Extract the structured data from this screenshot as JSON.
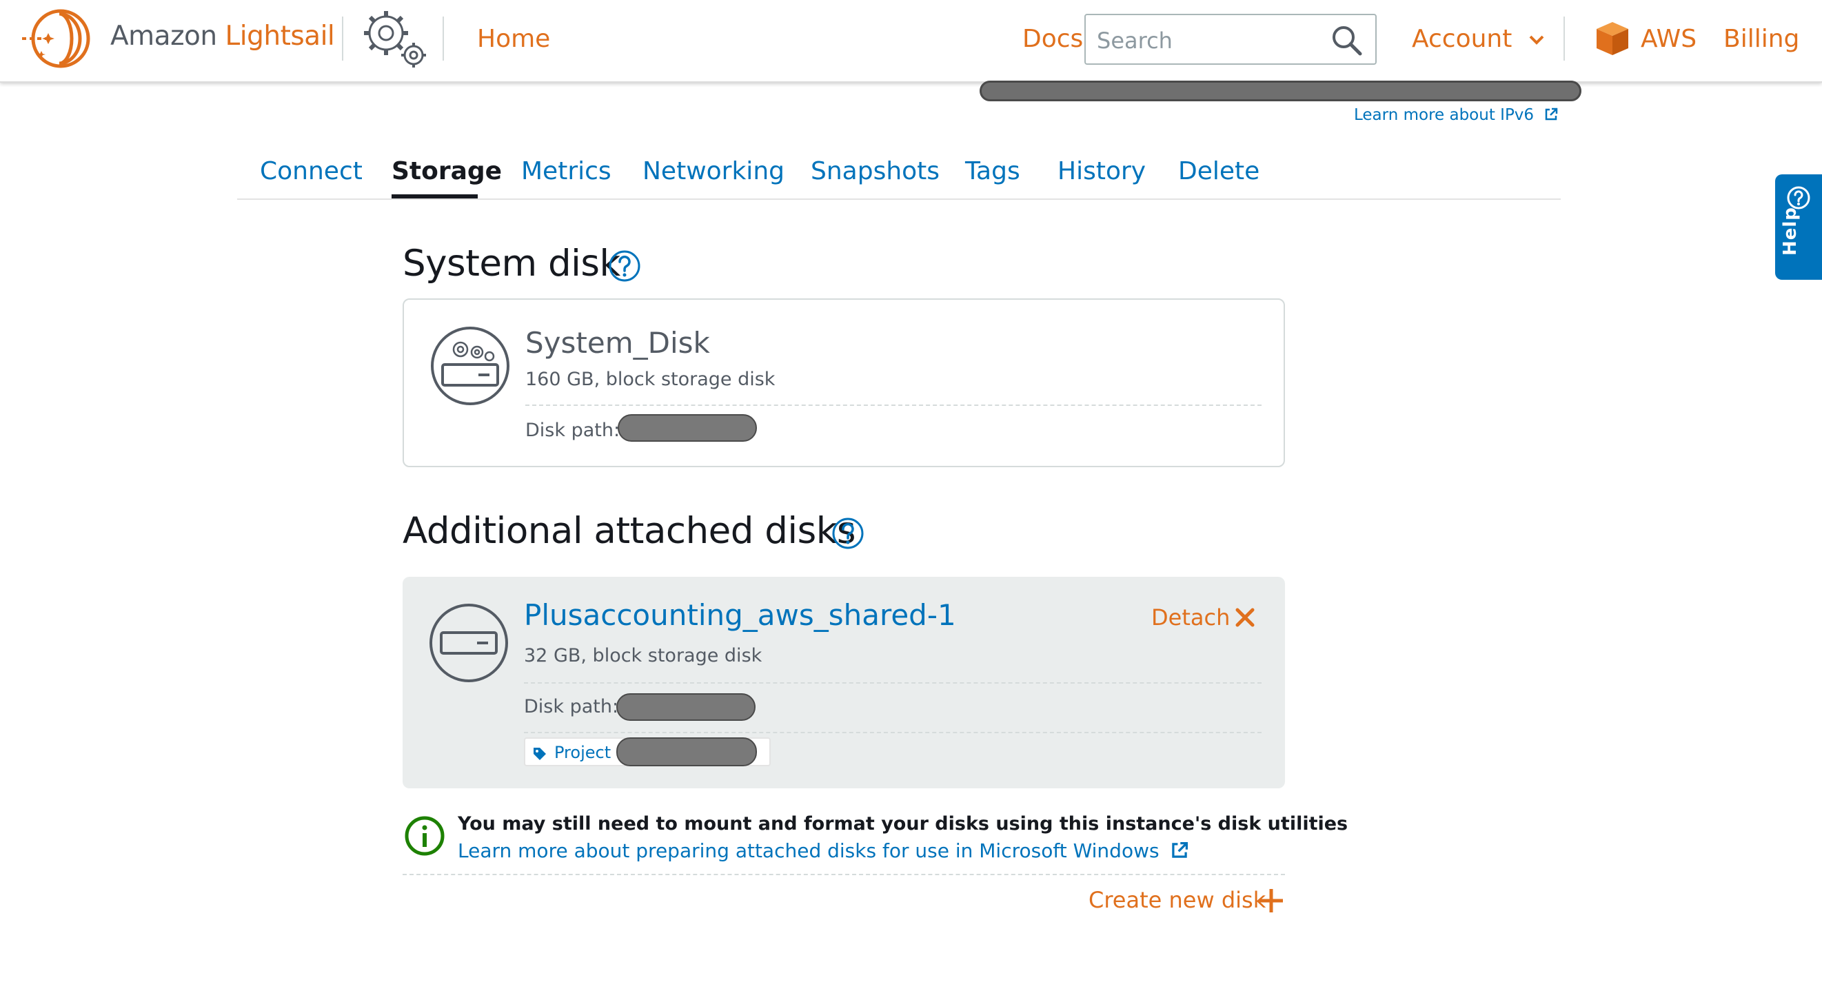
{
  "header": {
    "brand_part1": "Amazon",
    "brand_part2": "Lightsail",
    "home_label": "Home",
    "docs_label": "Docs",
    "search_placeholder": "Search",
    "account_label": "Account",
    "aws_label": "AWS",
    "billing_label": "Billing"
  },
  "ipv6_link": "Learn more about IPv6",
  "tabs": [
    {
      "label": "Connect",
      "active": false
    },
    {
      "label": "Storage",
      "active": true
    },
    {
      "label": "Metrics",
      "active": false
    },
    {
      "label": "Networking",
      "active": false
    },
    {
      "label": "Snapshots",
      "active": false
    },
    {
      "label": "Tags",
      "active": false
    },
    {
      "label": "History",
      "active": false
    },
    {
      "label": "Delete",
      "active": false
    }
  ],
  "system_disk": {
    "section_title": "System disk",
    "name": "System_Disk",
    "description": "160 GB, block storage disk",
    "path_label": "Disk path:"
  },
  "additional_disks": {
    "section_title": "Additional attached disks",
    "disks": [
      {
        "name": "Plusaccounting_aws_shared-1",
        "description": "32 GB, block storage disk",
        "path_label": "Disk path:",
        "detach_label": "Detach",
        "tag_key": "Project"
      }
    ]
  },
  "info_note": {
    "bold_text": "You may still need to mount and format your disks using this instance's disk utilities",
    "link_text": "Learn more about preparing attached disks for use in Microsoft Windows"
  },
  "create_disk_label": "Create new disk",
  "help_label": "Help",
  "colors": {
    "accent_orange": "#e0701d",
    "link_blue": "#0073bb",
    "text_dark": "#16191f",
    "text_gray": "#545b64",
    "info_green": "#1d8102",
    "card_gray": "#eaeded"
  },
  "icons": [
    "lightsail-logo-icon",
    "settings-gears-icon",
    "search-icon",
    "chevron-down-icon",
    "aws-cube-icon",
    "external-link-icon",
    "help-circle-icon",
    "system-disk-icon",
    "disk-icon",
    "close-icon",
    "tag-icon",
    "info-icon",
    "plus-icon"
  ]
}
